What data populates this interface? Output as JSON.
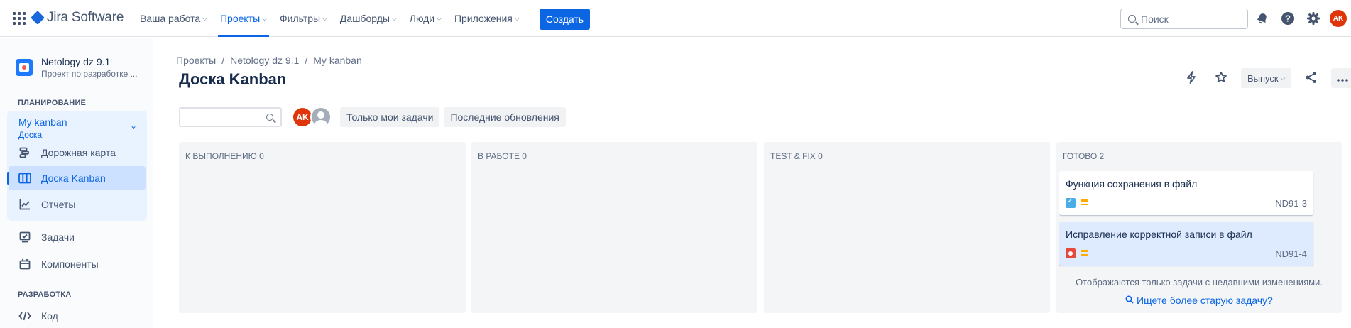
{
  "topnav": {
    "logo_text": "Jira Software",
    "menu": [
      {
        "label": "Ваша работа"
      },
      {
        "label": "Проекты"
      },
      {
        "label": "Фильтры"
      },
      {
        "label": "Дашборды"
      },
      {
        "label": "Люди"
      },
      {
        "label": "Приложения"
      }
    ],
    "create_label": "Создать",
    "search_placeholder": "Поиск",
    "user_initials": "AK"
  },
  "sidebar": {
    "project_name": "Netology dz 9.1",
    "project_sub": "Проект по разработке ...",
    "planning_header": "ПЛАНИРОВАНИЕ",
    "board_group_title": "My kanban",
    "board_group_sub": "Доска",
    "items": [
      {
        "label": "Дорожная карта",
        "icon": "roadmap-icon"
      },
      {
        "label": "Доска Kanban",
        "icon": "board-icon"
      },
      {
        "label": "Отчеты",
        "icon": "reports-icon"
      },
      {
        "label": "Задачи",
        "icon": "issues-icon"
      },
      {
        "label": "Компоненты",
        "icon": "components-icon"
      }
    ],
    "dev_header": "РАЗРАБОТКА",
    "dev_items": [
      {
        "label": "Код",
        "icon": "code-icon"
      }
    ]
  },
  "main": {
    "breadcrumb": [
      "Проекты",
      "Netology dz 9.1",
      "My kanban"
    ],
    "title": "Доска Kanban",
    "release_label": "Выпуск",
    "filters": {
      "avatar_initials": "AK",
      "only_my_issues": "Только мои задачи",
      "recently_updated": "Последние обновления"
    },
    "columns": [
      {
        "title": "К ВЫПОЛНЕНИЮ 0"
      },
      {
        "title": "В РАБОТЕ 0"
      },
      {
        "title": "TEST & FIX 0"
      },
      {
        "title": "ГОТОВО 2"
      }
    ],
    "done_cards": [
      {
        "title": "Функция сохранения в файл",
        "key": "ND91-3",
        "type": "task",
        "priority": "medium"
      },
      {
        "title": "Исправление корректной записи в файл",
        "key": "ND91-4",
        "type": "bug",
        "priority": "medium"
      }
    ],
    "done_note": "Отображаются только задачи с недавними изменениями.",
    "done_link": "Ищете более старую задачу?"
  },
  "colors": {
    "accent": "#0c66e4",
    "selected_bg": "#cce0ff",
    "column_bg": "#f4f5f7",
    "avatar": "#de350b"
  }
}
